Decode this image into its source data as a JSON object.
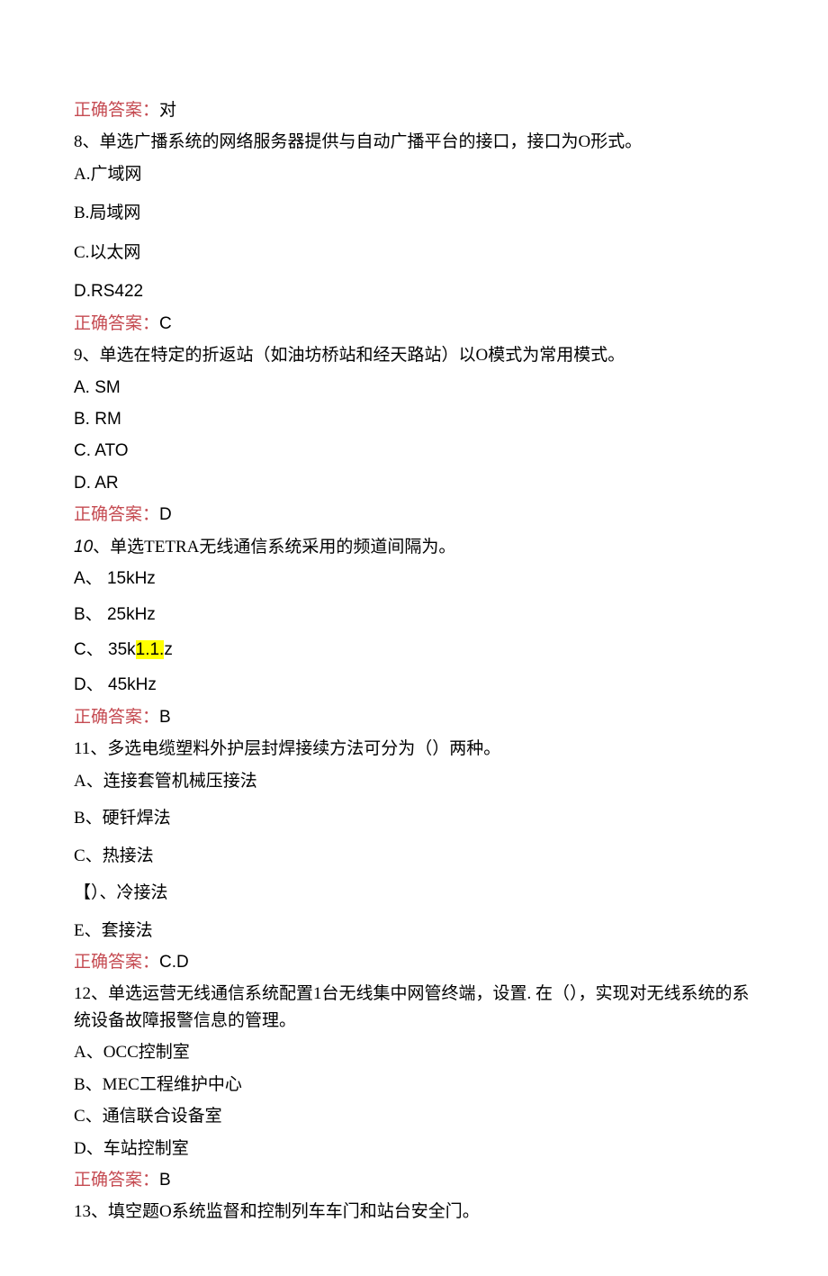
{
  "answer_label": "正确答案：",
  "q7": {
    "answer": "对"
  },
  "q8": {
    "prompt": "8、单选广播系统的网络服务器提供与自动广播平台的接口，接口为O形式。",
    "A": "A.广域网",
    "B": "B.局域网",
    "C": "C.以太网",
    "D": "D.RS422",
    "answer": "C"
  },
  "q9": {
    "prompt": "9、单选在特定的折返站（如油坊桥站和经天路站）以O模式为常用模式。",
    "A": "A.  SM",
    "B": "B.  RM",
    "C": "C.  ATO",
    "D": "D.  AR",
    "answer": "D"
  },
  "q10": {
    "num_italic": "10",
    "prompt_rest": "、单选TETRA无线通信系统采用的频道间隔为。",
    "A": "A、 15kHz",
    "B": "B、 25kHz",
    "C_pre": "C、 35k",
    "C_hl": "1.1.",
    "C_post": "z",
    "D": "D、 45kHz",
    "answer": "B"
  },
  "q11": {
    "prompt": "11、多选电缆塑料外护层封焊接续方法可分为（）两种。",
    "A": "A、连接套管机械压接法",
    "B": "B、硬钎焊法",
    "C": "C、热接法",
    "D": "【）、冷接法",
    "E": "E、套接法",
    "answer": "C.D"
  },
  "q12": {
    "prompt": "12、单选运营无线通信系统配置1台无线集中网管终端，设置. 在（），实现对无线系统的系统设备故障报警信息的管理。",
    "A": "A、OCC控制室",
    "B": "B、MEC工程维护中心",
    "C": "C、通信联合设备室",
    "D": "D、车站控制室",
    "answer": "B"
  },
  "q13": {
    "prompt": "13、填空题O系统监督和控制列车车门和站台安全门。"
  }
}
